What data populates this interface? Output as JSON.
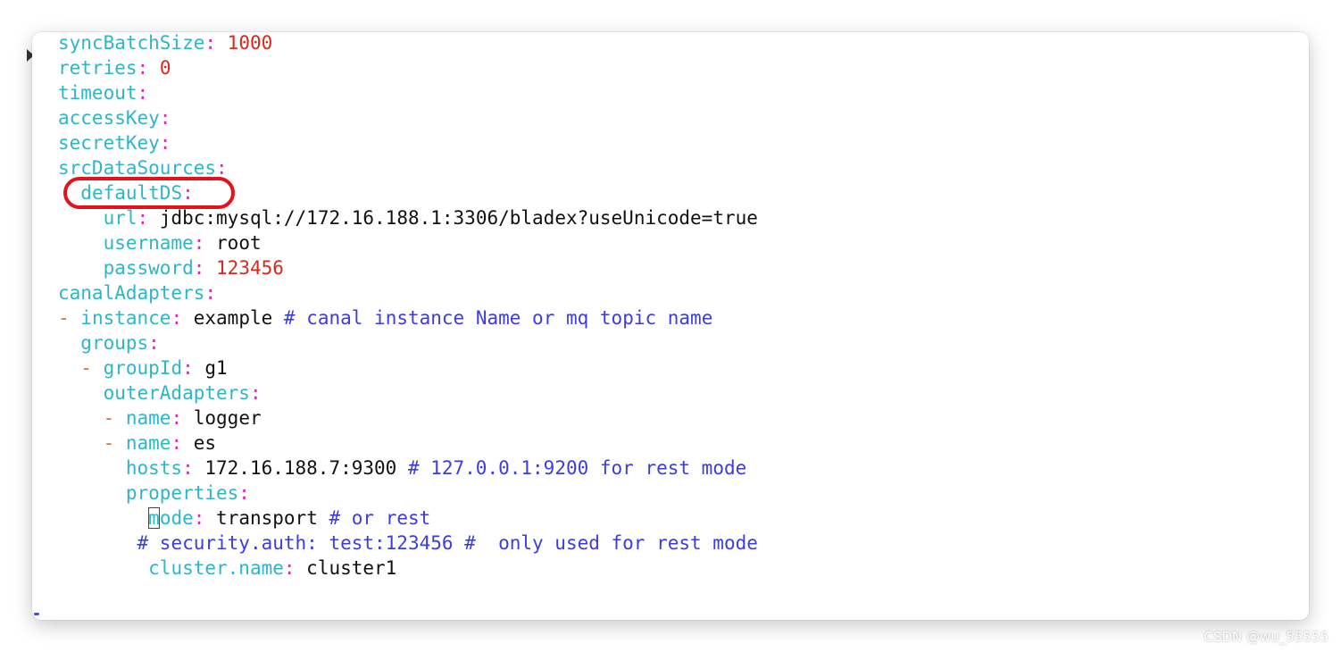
{
  "editor": {
    "lines": [
      {
        "indent": "",
        "dash": "",
        "key": "syncBatchSize",
        "value": " 1000",
        "value_type": "num",
        "comment": ""
      },
      {
        "indent": "",
        "dash": "",
        "key": "retries",
        "value": " 0",
        "value_type": "num",
        "comment": ""
      },
      {
        "indent": "",
        "dash": "",
        "key": "timeout",
        "value": "",
        "value_type": "val",
        "comment": ""
      },
      {
        "indent": "",
        "dash": "",
        "key": "accessKey",
        "value": "",
        "value_type": "val",
        "comment": ""
      },
      {
        "indent": "",
        "dash": "",
        "key": "secretKey",
        "value": "",
        "value_type": "val",
        "comment": ""
      },
      {
        "indent": "",
        "dash": "",
        "key": "srcDataSources",
        "value": "",
        "value_type": "val",
        "comment": ""
      },
      {
        "indent": "  ",
        "dash": "",
        "key": "defaultDS",
        "value": "",
        "value_type": "val",
        "comment": ""
      },
      {
        "indent": "    ",
        "dash": "",
        "key": "url",
        "value": " jdbc:mysql://172.16.188.1:3306/bladex?useUnicode=true",
        "value_type": "val",
        "comment": ""
      },
      {
        "indent": "    ",
        "dash": "",
        "key": "username",
        "value": " root",
        "value_type": "val",
        "comment": ""
      },
      {
        "indent": "    ",
        "dash": "",
        "key": "password",
        "value": " 123456",
        "value_type": "num",
        "comment": ""
      },
      {
        "indent": "",
        "dash": "",
        "key": "canalAdapters",
        "value": "",
        "value_type": "val",
        "comment": ""
      },
      {
        "indent": "",
        "dash": "- ",
        "key": "instance",
        "value": " example ",
        "value_type": "val",
        "comment": "# canal instance Name or mq topic name"
      },
      {
        "indent": "  ",
        "dash": "",
        "key": "groups",
        "value": "",
        "value_type": "val",
        "comment": ""
      },
      {
        "indent": "  ",
        "dash": "- ",
        "key": "groupId",
        "value": " g1",
        "value_type": "val",
        "comment": ""
      },
      {
        "indent": "    ",
        "dash": "",
        "key": "outerAdapters",
        "value": "",
        "value_type": "val",
        "comment": ""
      },
      {
        "indent": "    ",
        "dash": "- ",
        "key": "name",
        "value": " logger",
        "value_type": "val",
        "comment": ""
      },
      {
        "indent": "    ",
        "dash": "- ",
        "key": "name",
        "value": " es",
        "value_type": "val",
        "comment": ""
      },
      {
        "indent": "      ",
        "dash": "",
        "key": "hosts",
        "value": " 172.16.188.7:9300 ",
        "value_type": "val",
        "comment": "# 127.0.0.1:9200 for rest mode"
      },
      {
        "indent": "      ",
        "dash": "",
        "key": "properties",
        "value": "",
        "value_type": "val",
        "comment": ""
      },
      {
        "indent": "        ",
        "dash": "",
        "key": "mode",
        "value": " transport ",
        "value_type": "val",
        "comment": "# or rest",
        "cursor": true
      },
      {
        "indent": "       ",
        "dash": "",
        "key": "",
        "value": "",
        "value_type": "val",
        "comment": "# security.auth: test:123456 #  only used for rest mode"
      },
      {
        "indent": "        ",
        "dash": "",
        "key": "cluster.name",
        "value": " cluster1",
        "value_type": "val",
        "comment": ""
      }
    ]
  },
  "watermark": "CSDN @wu_55555",
  "colors": {
    "key": "#2eb6c8",
    "colon": "#d12fb3",
    "number": "#d8291c",
    "dash": "#d8722a",
    "comment": "#3c3ce0",
    "highlight": "#e3121b"
  }
}
